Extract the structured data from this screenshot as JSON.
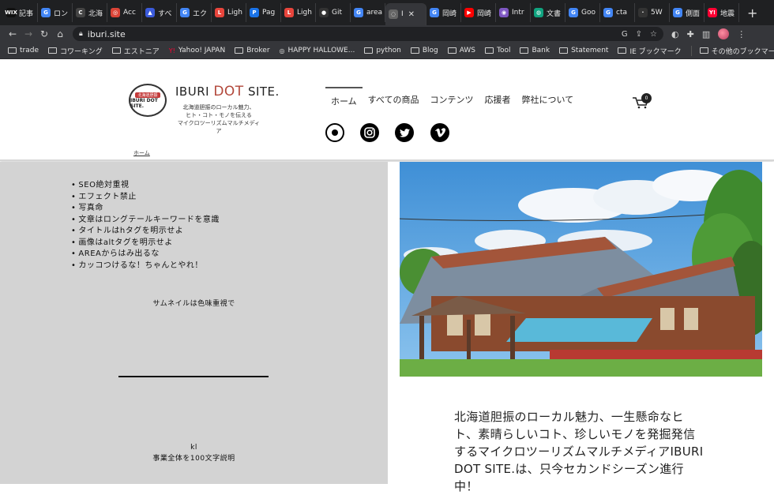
{
  "browser": {
    "tabs": [
      {
        "label": "記事",
        "fav": "WIX",
        "color": "#111111"
      },
      {
        "label": "ロン",
        "fav": "G",
        "color": "#4285f4"
      },
      {
        "label": "北海",
        "fav": "C",
        "color": "#444444"
      },
      {
        "label": "Acc",
        "fav": "◎",
        "color": "#db4437"
      },
      {
        "label": "すべ",
        "fav": "▲",
        "color": "#3b5bdb"
      },
      {
        "label": "エク",
        "fav": "G",
        "color": "#4285f4"
      },
      {
        "label": "Ligh",
        "fav": "L",
        "color": "#e8453c"
      },
      {
        "label": "Pag",
        "fav": "P",
        "color": "#1a73e8"
      },
      {
        "label": "Ligh",
        "fav": "L",
        "color": "#e8453c"
      },
      {
        "label": "Git",
        "fav": "●",
        "color": "#333333"
      },
      {
        "label": "area",
        "fav": "G",
        "color": "#4285f4"
      },
      {
        "label": "I",
        "fav": "◌",
        "color": "#666666",
        "active": true
      },
      {
        "label": "岡崎",
        "fav": "G",
        "color": "#4285f4"
      },
      {
        "label": "岡崎",
        "fav": "▶",
        "color": "#ff0000"
      },
      {
        "label": "Intr",
        "fav": "◉",
        "color": "#7e57c2"
      },
      {
        "label": "文書",
        "fav": "◍",
        "color": "#10a37f"
      },
      {
        "label": "Goo",
        "fav": "G",
        "color": "#4285f4"
      },
      {
        "label": "cta",
        "fav": "G",
        "color": "#4285f4"
      },
      {
        "label": "5W",
        "fav": "·",
        "color": "#333333"
      },
      {
        "label": "側面",
        "fav": "G",
        "color": "#4285f4"
      },
      {
        "label": "地震",
        "fav": "Y!",
        "color": "#ff0033"
      }
    ],
    "url": "iburi.site",
    "bookmarks": [
      {
        "label": "trade",
        "type": "folder"
      },
      {
        "label": "コワーキング",
        "type": "folder"
      },
      {
        "label": "エストニア",
        "type": "folder"
      },
      {
        "label": "Yahoo! JAPAN",
        "type": "yahoo"
      },
      {
        "label": "Broker",
        "type": "folder"
      },
      {
        "label": "HAPPY HALLOWE...",
        "type": "site"
      },
      {
        "label": "python",
        "type": "folder"
      },
      {
        "label": "Blog",
        "type": "folder"
      },
      {
        "label": "AWS",
        "type": "folder"
      },
      {
        "label": "Tool",
        "type": "folder"
      },
      {
        "label": "Bank",
        "type": "folder"
      },
      {
        "label": "Statement",
        "type": "folder"
      },
      {
        "label": "IE ブックマーク",
        "type": "folder"
      }
    ],
    "other_bookmarks": "その他のブックマーク"
  },
  "site": {
    "logo_ribbon": "北海道胆振",
    "logo_text": "IBURI DOT SITE.",
    "brand_part1": "IBURI ",
    "brand_part2": "DOT",
    "brand_part3": " SITE.",
    "tagline_lines": [
      "北海道胆振のローカル魅力、",
      "ヒト・コト・モノを伝える",
      "マイクロツーリズムマルチメディア"
    ],
    "nav": [
      "ホーム",
      "すべての商品",
      "コンテンツ",
      "応援者",
      "弊社について"
    ],
    "cart_count": "0",
    "breadcrumb": "ホーム"
  },
  "content": {
    "bullets": [
      "SEO絶対重視",
      "エフェクト禁止",
      "写真命",
      "文章はロングテールキーワードを意識",
      "タイトルはhタグを明示せよ",
      "画像はaltタグを明示せよ",
      "AREAからはみ出るな",
      "カッコつけるな！ちゃんとやれ！"
    ],
    "thumbnail_note": "サムネイルは色味重視で",
    "kl_label": "kl",
    "kl_desc": "事業全体を100文字説明",
    "intro_text": "北海道胆振のローカル魅力、一生懸命なヒト、素晴らしいコト、珍しいモノを発掘発信するマイクロツーリズムマルチメディアIBURI DOT SITE.は、只今セカンドシーズン進行中！"
  }
}
